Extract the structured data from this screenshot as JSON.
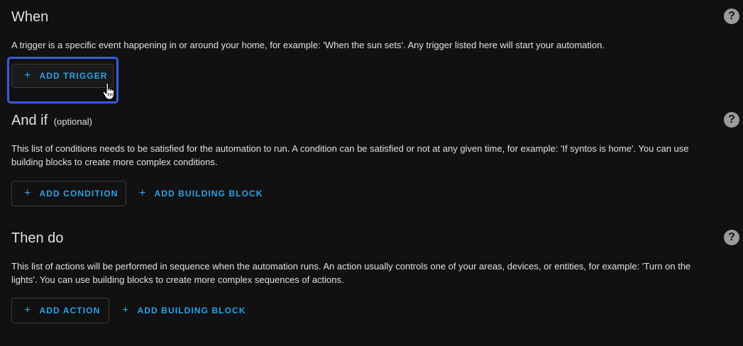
{
  "when": {
    "title": "When",
    "description": "A trigger is a specific event happening in or around your home, for example: 'When the sun sets'. Any trigger listed here will start your automation.",
    "add_trigger_label": "ADD TRIGGER"
  },
  "and_if": {
    "title": "And if",
    "optional_label": "(optional)",
    "description_line1": "This list of conditions needs to be satisfied for the automation to run. A condition can be satisfied or not at any given time, for example: 'If syntos is home'. You can use",
    "description_line2": "building blocks to create more complex conditions.",
    "add_condition_label": "ADD CONDITION",
    "add_building_block_label": "ADD BUILDING BLOCK"
  },
  "then_do": {
    "title": "Then do",
    "description_line1": "This list of actions will be performed in sequence when the automation runs. An action usually controls one of your areas, devices, or entities, for example: 'Turn on the",
    "description_line2": "lights'. You can use building blocks to create more complex sequences of actions.",
    "add_action_label": "ADD ACTION",
    "add_building_block_label": "ADD BUILDING BLOCK"
  },
  "help_icon_glyph": "?",
  "plus_glyph": "+",
  "colors": {
    "background": "#111111",
    "text": "#e1e1e1",
    "accent": "#2ba2e8",
    "focus_ring": "#3b5bdb",
    "help_icon": "#9b9b9b"
  },
  "icons": {
    "help": "help-circle-icon",
    "plus": "plus-icon",
    "cursor": "hand-pointer-icon"
  }
}
